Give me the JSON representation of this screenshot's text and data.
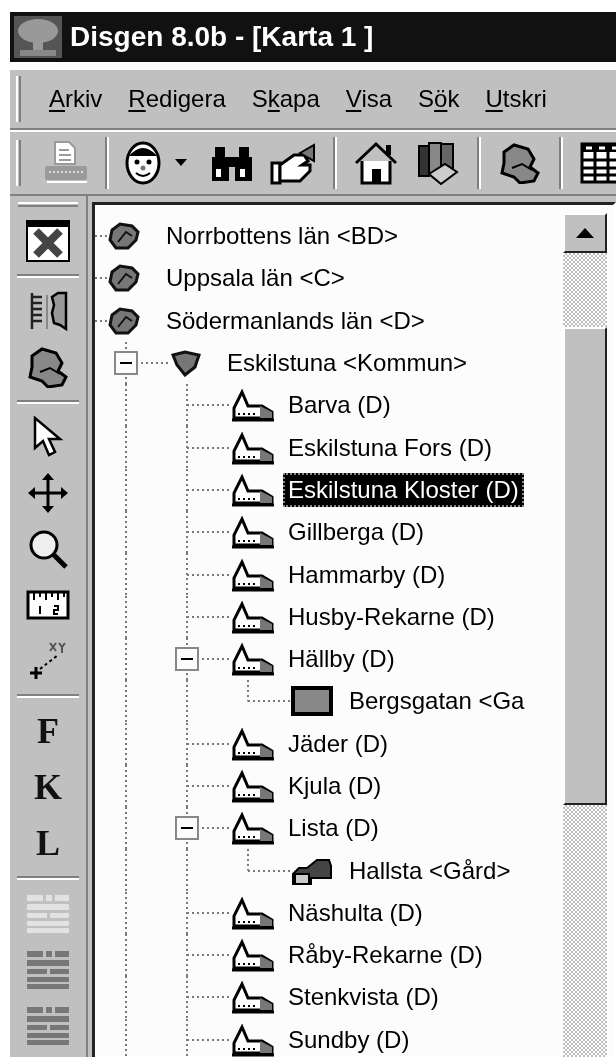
{
  "window": {
    "title": "Disgen 8.0b - [Karta 1 ]"
  },
  "menu": [
    {
      "key": "A",
      "after": "rkiv"
    },
    {
      "key": "R",
      "after": "edigera"
    },
    {
      "before": "S",
      "key": "k",
      "after": "apa"
    },
    {
      "key": "V",
      "after": "isa"
    },
    {
      "before": "S",
      "key": "ö",
      "after": "k"
    },
    {
      "key": "U",
      "after": "tskri"
    }
  ],
  "toolbar": [
    {
      "kind": "print",
      "disabled": true
    },
    {
      "kind": "separator"
    },
    {
      "kind": "person"
    },
    {
      "kind": "binoculars"
    },
    {
      "kind": "hand"
    },
    {
      "kind": "separator"
    },
    {
      "kind": "house"
    },
    {
      "kind": "books"
    },
    {
      "kind": "separator"
    },
    {
      "kind": "map"
    },
    {
      "kind": "separator"
    },
    {
      "kind": "table"
    }
  ],
  "side_toolbar": [
    {
      "kind": "close"
    },
    {
      "kind": "separator"
    },
    {
      "kind": "layers"
    },
    {
      "kind": "map"
    },
    {
      "kind": "separator"
    },
    {
      "kind": "pointer"
    },
    {
      "kind": "move"
    },
    {
      "kind": "zoom"
    },
    {
      "kind": "ruler"
    },
    {
      "kind": "coordinates"
    },
    {
      "kind": "separator"
    },
    {
      "kind": "letter",
      "label": "F"
    },
    {
      "kind": "letter",
      "label": "K"
    },
    {
      "kind": "letter",
      "label": "L"
    },
    {
      "kind": "separator"
    },
    {
      "kind": "layout",
      "disabled": true
    },
    {
      "kind": "layout",
      "disabled": false
    },
    {
      "kind": "layout",
      "disabled": false
    }
  ],
  "tree": [
    {
      "label": "Norrbottens län <BD>",
      "kind": "county",
      "selected": false
    },
    {
      "label": "Uppsala län <C>",
      "kind": "county",
      "selected": false
    },
    {
      "label": "Södermanlands län <D>",
      "kind": "county",
      "selected": false,
      "children": [
        {
          "label": "Eskilstuna <Kommun>",
          "kind": "municipality",
          "selected": false,
          "expanded": true,
          "children": [
            {
              "label": "Barva (D)",
              "kind": "parish",
              "selected": false
            },
            {
              "label": "Eskilstuna Fors (D)",
              "kind": "parish",
              "selected": false
            },
            {
              "label": "Eskilstuna Kloster (D)",
              "kind": "parish",
              "selected": true
            },
            {
              "label": "Gillberga (D)",
              "kind": "parish",
              "selected": false
            },
            {
              "label": "Hammarby (D)",
              "kind": "parish",
              "selected": false
            },
            {
              "label": "Husby-Rekarne (D)",
              "kind": "parish",
              "selected": false
            },
            {
              "label": "Hällby (D)",
              "kind": "parish",
              "selected": false,
              "expanded": true,
              "children": [
                {
                  "label": "Bergsgatan <Ga",
                  "kind": "street",
                  "selected": false
                }
              ]
            },
            {
              "label": "Jäder (D)",
              "kind": "parish",
              "selected": false
            },
            {
              "label": "Kjula (D)",
              "kind": "parish",
              "selected": false
            },
            {
              "label": "Lista (D)",
              "kind": "parish",
              "selected": false,
              "expanded": true,
              "children": [
                {
                  "label": "Hallsta <Gård>",
                  "kind": "farm",
                  "selected": false
                }
              ]
            },
            {
              "label": "Näshulta (D)",
              "kind": "parish",
              "selected": false
            },
            {
              "label": "Råby-Rekarne (D)",
              "kind": "parish",
              "selected": false
            },
            {
              "label": "Stenkvista (D)",
              "kind": "parish",
              "selected": false
            },
            {
              "label": "Sundby (D)",
              "kind": "parish",
              "selected": false
            }
          ]
        }
      ]
    }
  ]
}
